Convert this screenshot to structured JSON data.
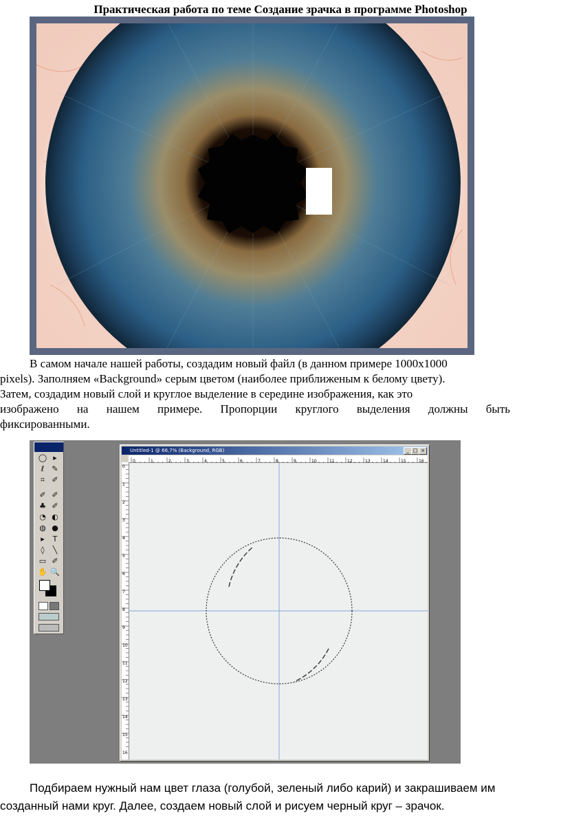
{
  "title": "Практическая работа по теме Создание зрачка в программе Photoshop",
  "paragraph1": {
    "line1": "В самом начале нашей работы, создадим новый файл (в данном примере 1000x1000",
    "line2": "pixels). Заполняем «Background» серым цветом (наиболее приближеным к белому цвету).",
    "line3": "Затем, создадим новый слой и круглое выделение в середине изображения, как это",
    "line4": "изображено на нашем примере. Пропорции круглого выделения должны быть",
    "line5": "фиксированными."
  },
  "photoshop": {
    "window_title": "Untitled-1 @ 66,7% (Background, RGB)",
    "min_btn": "_",
    "max_btn": "□",
    "close_btn": "×",
    "ruler_top_labels": [
      "0",
      "1",
      "2",
      "3",
      "4",
      "5",
      "6",
      "7",
      "8",
      "9",
      "10",
      "11",
      "12",
      "13",
      "14",
      "15",
      "16",
      "17"
    ],
    "tools": [
      "◯",
      "▸",
      "ℓ",
      "✎",
      "⌗",
      "✐",
      "✐",
      "✐",
      "♣",
      "✐",
      "◔",
      "◐",
      "◍",
      "●",
      "▸",
      "T",
      "◊",
      "╲",
      "▭",
      "✐",
      "✋",
      "🔍"
    ]
  },
  "paragraph2": {
    "line1": "Подбираем нужный нам цвет глаза (голубой, зеленый либо карий) и закрашиваем им",
    "line2": "созданный нами круг. Далее, создаем новый слой и рисуем черный круг – зрачок."
  },
  "colors": {
    "iris_dark": "#1b3b55",
    "iris_blue": "#3a6f93",
    "iris_amber": "#9a7a52",
    "guide_blue": "#7fa8d8",
    "titlebar": "#0a246a"
  }
}
